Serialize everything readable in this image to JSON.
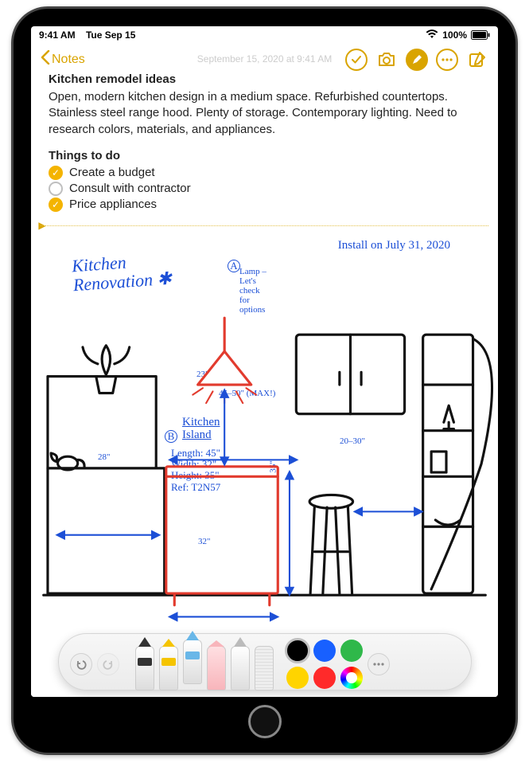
{
  "status": {
    "time": "9:41 AM",
    "date": "Tue Sep 15",
    "battery": "100%"
  },
  "toolbar": {
    "back_label": "Notes"
  },
  "note": {
    "date_line": "September 15, 2020 at 9:41 AM",
    "title": "Kitchen remodel ideas",
    "body": "Open, modern kitchen design in a medium space. Refurbished countertops. Stainless steel range hood. Plenty of storage. Contemporary lighting. Need to research colors, materials, and appliances.",
    "subhead": "Things to do",
    "todos": [
      {
        "label": "Create a budget",
        "done": true
      },
      {
        "label": "Consult with contractor",
        "done": false
      },
      {
        "label": "Price appliances",
        "done": true
      }
    ]
  },
  "sketch": {
    "title": "Kitchen\nRenovation ✱",
    "install": "Install on July 31, 2020",
    "lamp_note": "Lamp –\nLet's\ncheck\nfor\noptions",
    "marker_a": "A",
    "marker_b": "B",
    "island_label": "Kitchen\nIsland",
    "island_specs": "Length: 45\"\nWidth: 32\"\nHeight: 35\"\nRef: T2N57",
    "dims": {
      "lamp_drop": "23\"",
      "gap_range": "45–50\" (MAX!)",
      "left": "28\"",
      "island_width": "32\"",
      "island_height": "35\"",
      "shelf_gap": "20–30\""
    }
  },
  "palette": {
    "colors": [
      "#000000",
      "#1860ff",
      "#2fb84a",
      "#ffd400",
      "#ff2a2a"
    ]
  }
}
